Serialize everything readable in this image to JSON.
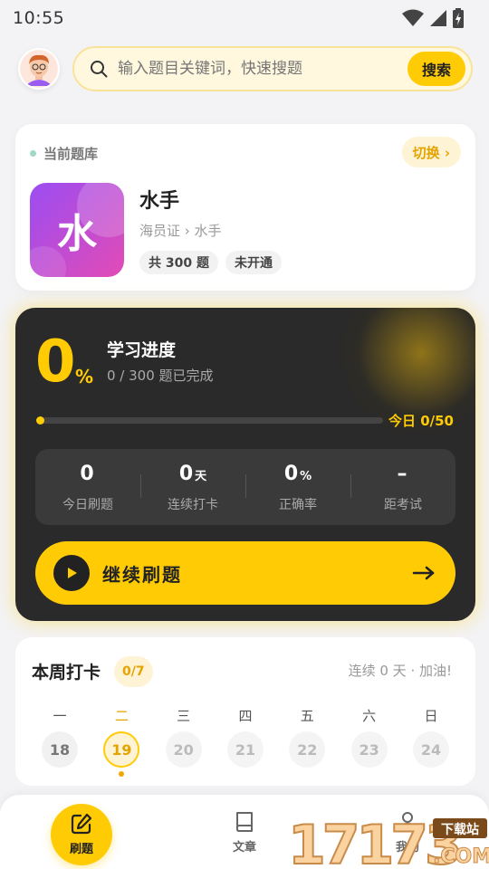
{
  "status_bar": {
    "time": "10:55"
  },
  "search": {
    "placeholder": "输入题目关键词，快速搜题",
    "button_label": "搜索"
  },
  "bank": {
    "label": "当前题库",
    "switch_label": "切换 ›",
    "logo_char": "水",
    "name": "水手",
    "path": "海员证 › 水手",
    "tags": [
      "共 300 题",
      "未开通"
    ]
  },
  "progress": {
    "percent": "0",
    "percent_sign": "%",
    "fraction_complete": 0,
    "title": "学习进度",
    "subtitle": "0 / 300 题已完成",
    "today_label": "今日 0/50",
    "stats": [
      {
        "value": "0",
        "unit": "",
        "label": "今日刷题"
      },
      {
        "value": "0",
        "unit": "天",
        "label": "连续打卡"
      },
      {
        "value": "0",
        "unit": "%",
        "label": "正确率"
      },
      {
        "value": "–",
        "unit": "",
        "label": "距考试"
      }
    ],
    "continue_label": "继续刷题"
  },
  "week": {
    "title": "本周打卡",
    "count": "0/7",
    "streak": "连续 0 天 · 加油!",
    "days": [
      {
        "name": "一",
        "date": "18",
        "state": "past"
      },
      {
        "name": "二",
        "date": "19",
        "state": "today"
      },
      {
        "name": "三",
        "date": "20",
        "state": "future"
      },
      {
        "name": "四",
        "date": "21",
        "state": "future"
      },
      {
        "name": "五",
        "date": "22",
        "state": "future"
      },
      {
        "name": "六",
        "date": "23",
        "state": "future"
      },
      {
        "name": "日",
        "date": "24",
        "state": "future"
      }
    ]
  },
  "nav": {
    "items": [
      {
        "label": "刷题",
        "icon": "edit-icon",
        "active": true
      },
      {
        "label": "文章",
        "icon": "book-icon",
        "active": false
      },
      {
        "label": "我的",
        "icon": "user-icon",
        "active": false
      }
    ]
  },
  "watermark": {
    "number": "17173",
    "site": "下载站",
    "domain": ".COM"
  },
  "colors": {
    "accent": "#ffcb05",
    "accent_text": "#e5a300",
    "dark_card": "#2a2a2a",
    "bank_gradient": [
      "#9b4df3",
      "#e24bb5"
    ]
  }
}
